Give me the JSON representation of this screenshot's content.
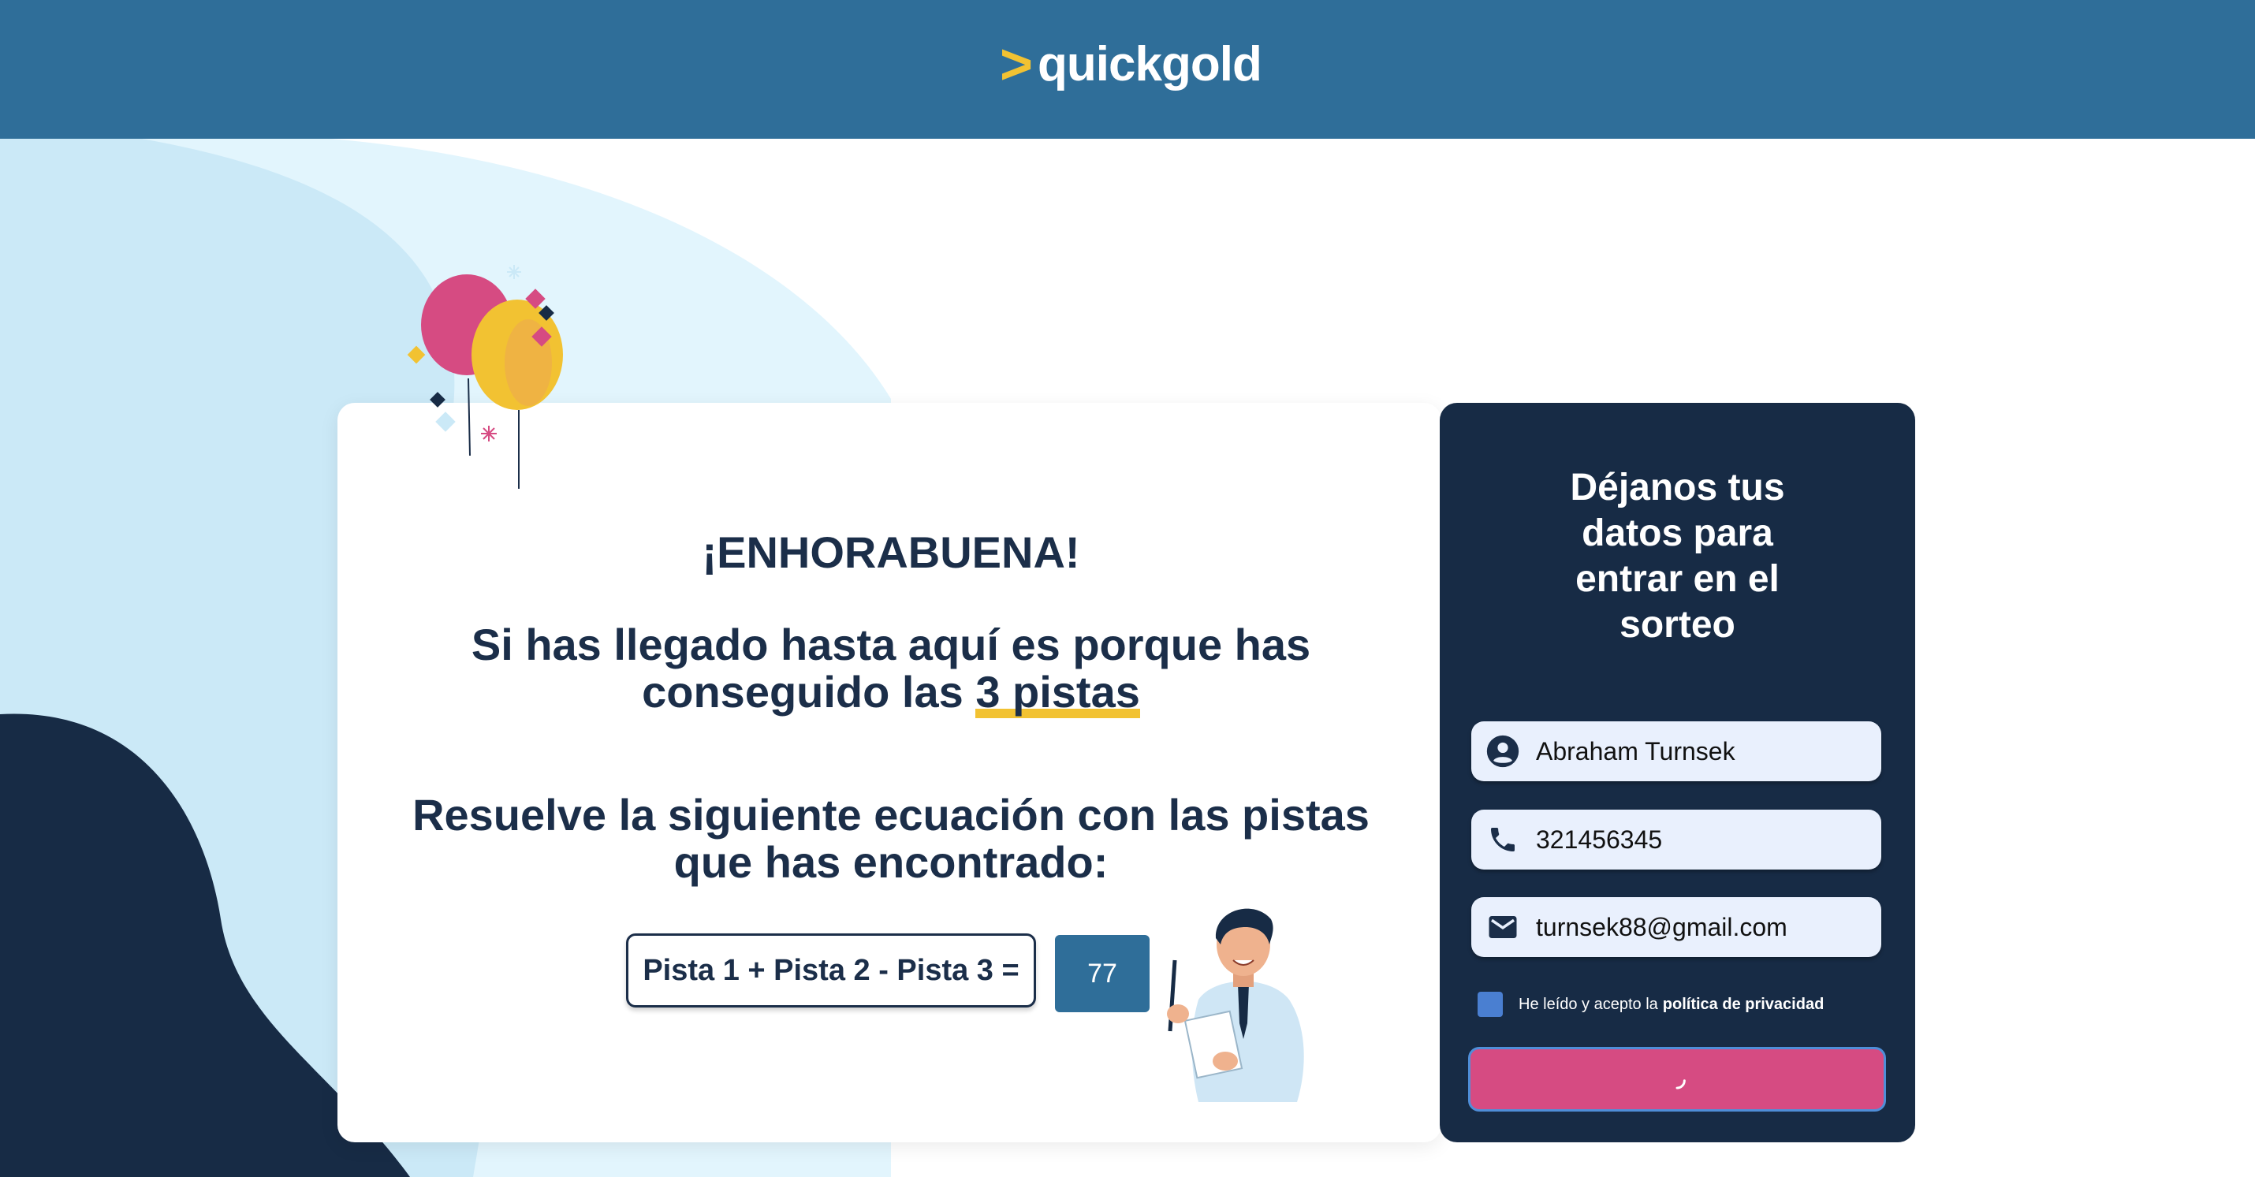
{
  "header": {
    "logo_arrow": ">",
    "logo_text": "quickgold",
    "background_color": "#2f6e99",
    "accent_color": "#f2c232"
  },
  "main": {
    "congrats": "¡ENHORABUENA!",
    "message_prefix": "Si has llegado hasta aquí es porque has conseguido las",
    "message_highlight": "3 pistas",
    "instruction": "Resuelve la siguiente ecuación con las pistas que has encontrado:",
    "equation": "Pista 1 + Pista 2 - Pista 3 =",
    "answer_value": "77"
  },
  "form": {
    "title_lines": [
      "Déjanos tus",
      "datos para",
      "entrar en el",
      "sorteo"
    ],
    "name_value": "Abraham Turnsek",
    "name_icon": "account-circle-icon",
    "phone_value": "321456345",
    "phone_icon": "phone-icon",
    "email_value": "turnsek88@gmail.com",
    "email_icon": "email-icon",
    "consent_text": "He leído y acepto la",
    "consent_link": "política de privacidad",
    "submit_state": "loading",
    "panel_color": "#172b45",
    "button_color": "#d64b82"
  }
}
